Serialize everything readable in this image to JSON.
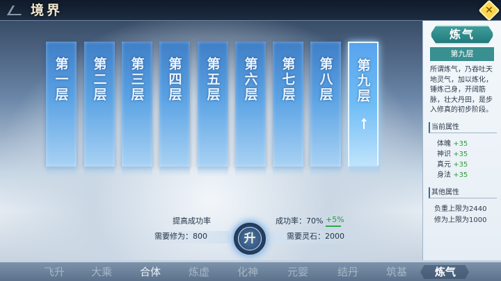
{
  "header": {
    "title": "境界",
    "close_icon": "close-icon"
  },
  "pillars": [
    {
      "label": "第一层",
      "active": false
    },
    {
      "label": "第二层",
      "active": false
    },
    {
      "label": "第三层",
      "active": false
    },
    {
      "label": "第四层",
      "active": false
    },
    {
      "label": "第五层",
      "active": false
    },
    {
      "label": "第六层",
      "active": false
    },
    {
      "label": "第七层",
      "active": false
    },
    {
      "label": "第八层",
      "active": false
    },
    {
      "label": "第九层",
      "active": true
    }
  ],
  "upgrade": {
    "boost_label": "提高成功率",
    "required_cultivation": "需要修为：800",
    "success_rate": "成功率：70%",
    "success_bonus": "+5%",
    "required_stone": "需要灵石：2000",
    "ascend_label": "升"
  },
  "info": {
    "realm_name": "炼气",
    "layer": "第九层",
    "description": "所谓炼气，乃吞吐天地灵气，加以炼化，锤炼己身，开阔筋脉，壮大丹田，是步入修真的初步阶段。",
    "current_attrs_title": "当前属性",
    "current_attrs": [
      {
        "name": "体魄",
        "value": "+35"
      },
      {
        "name": "神识",
        "value": "+35"
      },
      {
        "name": "真元",
        "value": "+35"
      },
      {
        "name": "身法",
        "value": "+35"
      }
    ],
    "other_attrs_title": "其他属性",
    "other_attrs": [
      "负重上限为2440",
      "修为上限为1000"
    ]
  },
  "tabs": [
    {
      "label": "飞升",
      "state": "dim"
    },
    {
      "label": "大乘",
      "state": "dim"
    },
    {
      "label": "合体",
      "state": "done"
    },
    {
      "label": "炼虚",
      "state": "dim"
    },
    {
      "label": "化神",
      "state": "dim"
    },
    {
      "label": "元婴",
      "state": "dim"
    },
    {
      "label": "结丹",
      "state": "dim"
    },
    {
      "label": "筑基",
      "state": "dim"
    },
    {
      "label": "炼气",
      "state": "active"
    }
  ],
  "colors": {
    "accent_gold": "#ffd54a",
    "pillar_blue": "#5aa2e4",
    "bonus_green": "#2e9a3e"
  }
}
